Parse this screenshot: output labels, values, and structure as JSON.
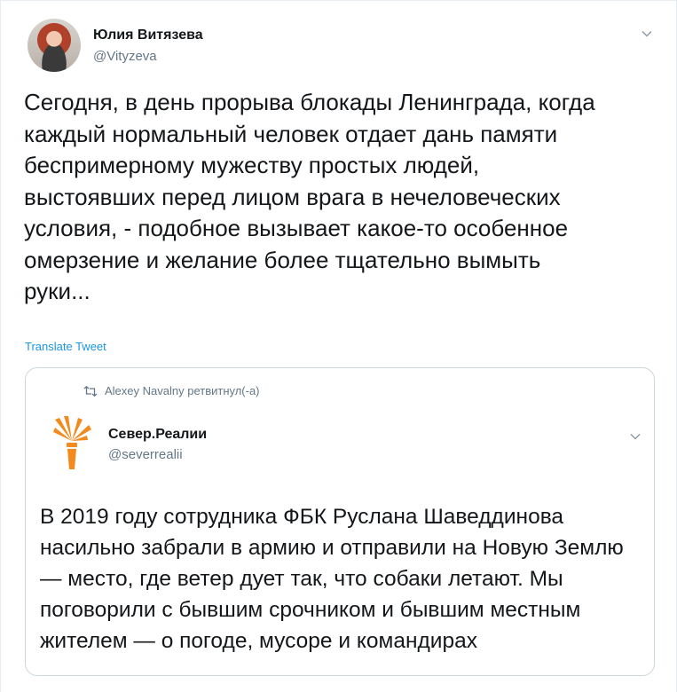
{
  "tweet": {
    "author": {
      "name": "Юлия Витязева",
      "handle": "@Vityzeva"
    },
    "text": "Сегодня, в день прорыва блокады Ленинграда, когда\nкаждый нормальный человек отдает дань памяти\nбеспримерному мужеству простых людей,\nвыстоявших перед лицом врага в нечеловеческих\nусловия, - подобное вызывает какое-то особенное\nомерзение и желание более тщательно вымыть\nруки...",
    "translate_label": "Translate Tweet",
    "icons": {
      "more": "chevron-down-icon",
      "retweet": "retweet-icon",
      "logo": "radio-liberty-logo"
    }
  },
  "quoted": {
    "retweet_label": "Alexey Navalny ретвитнул(-а)",
    "author": {
      "name": "Север.Реалии",
      "handle": "@severrealii"
    },
    "text": "В 2019 году сотрудника ФБК Руслана Шаведдинова\nнасильно забрали в армию и отправили на Новую Землю\n— место, где ветер дует так, что собаки летают. Мы\nпоговорили с бывшим срочником и бывшим местным\nжителем — о погоде, мусоре и командирах"
  },
  "colors": {
    "text": "#14171a",
    "secondary": "#657786",
    "link": "#1b95e0",
    "border": "#ccd6dd",
    "logo_orange": "#f28a1e"
  }
}
